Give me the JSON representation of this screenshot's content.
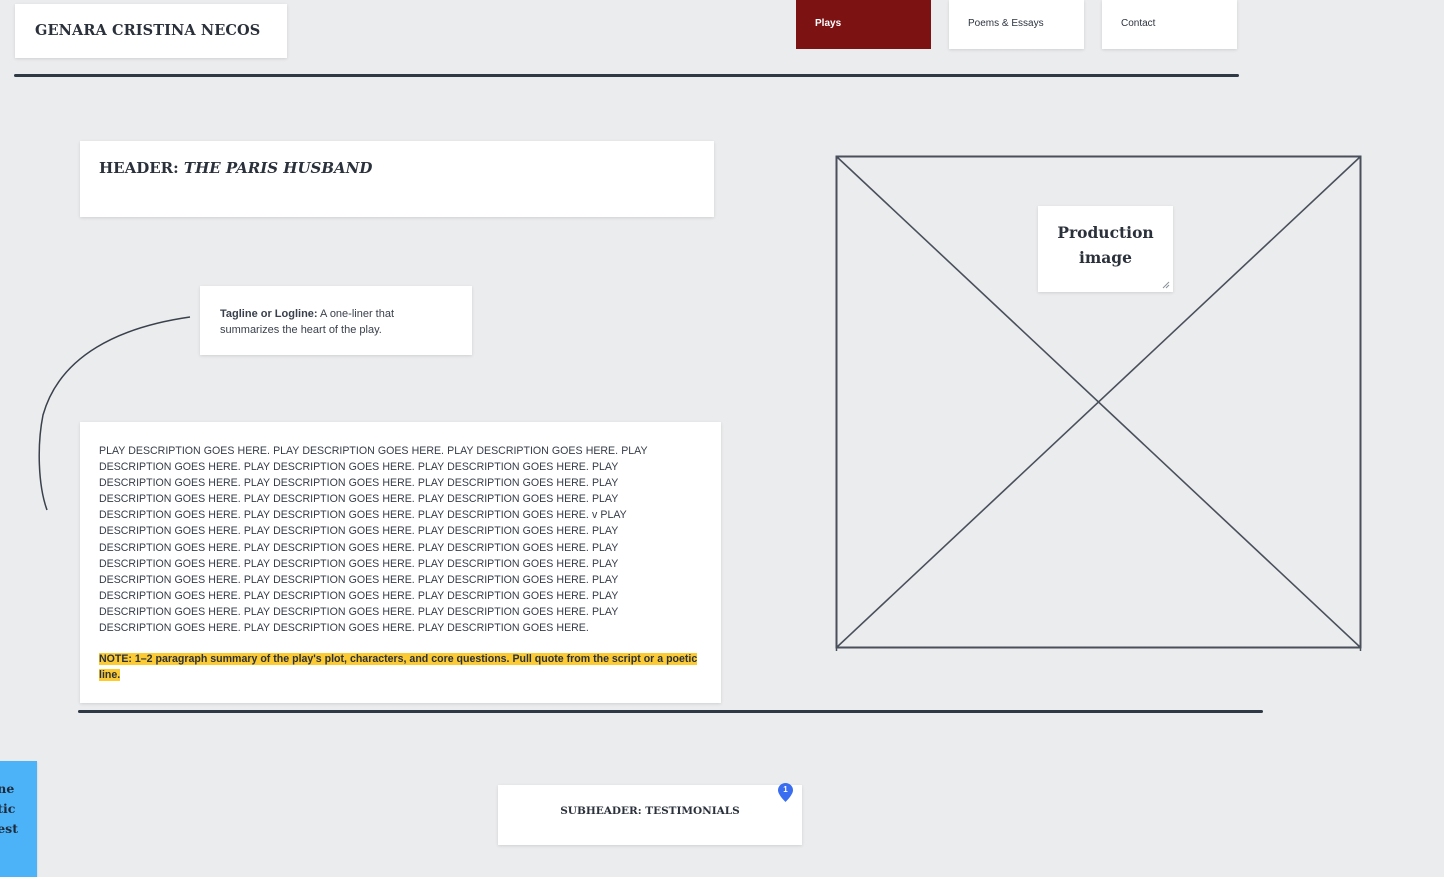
{
  "site": {
    "title": "GENARA CRISTINA NECOS"
  },
  "nav": {
    "plays": "Plays",
    "poems": "Poems & Essays",
    "contact": "Contact",
    "active_color": "#7d1213"
  },
  "play_header": {
    "prefix": "HEADER: ",
    "title": "THE PARIS HUSBAND"
  },
  "tagline": {
    "label": "Tagline or Logline:",
    "text": " A one-liner that summarizes the heart of the play."
  },
  "description": {
    "body": "PLAY DESCRIPTION GOES HERE. PLAY DESCRIPTION GOES HERE. PLAY DESCRIPTION GOES HERE. PLAY DESCRIPTION GOES HERE. PLAY DESCRIPTION GOES HERE. PLAY DESCRIPTION GOES HERE. PLAY DESCRIPTION GOES HERE. PLAY DESCRIPTION GOES HERE. PLAY DESCRIPTION GOES HERE. PLAY DESCRIPTION GOES HERE. PLAY DESCRIPTION GOES HERE. PLAY DESCRIPTION GOES HERE. PLAY DESCRIPTION GOES HERE. PLAY DESCRIPTION GOES HERE. PLAY DESCRIPTION GOES HERE. v PLAY DESCRIPTION GOES HERE. PLAY DESCRIPTION GOES HERE. PLAY DESCRIPTION GOES HERE. PLAY DESCRIPTION GOES HERE. PLAY DESCRIPTION GOES HERE. PLAY DESCRIPTION GOES HERE. PLAY DESCRIPTION GOES HERE. PLAY DESCRIPTION GOES HERE.  PLAY DESCRIPTION GOES HERE. PLAY DESCRIPTION GOES HERE. PLAY DESCRIPTION GOES HERE. PLAY DESCRIPTION GOES HERE. PLAY DESCRIPTION GOES HERE. PLAY DESCRIPTION GOES HERE. PLAY DESCRIPTION GOES HERE. PLAY DESCRIPTION GOES HERE. PLAY DESCRIPTION GOES HERE. PLAY DESCRIPTION GOES HERE. PLAY DESCRIPTION GOES HERE. PLAY DESCRIPTION GOES HERE. PLAY DESCRIPTION GOES HERE.",
    "note": "NOTE:  1–2 paragraph summary of the play's plot, characters, and core questions. Pull quote from the script or a poetic line.",
    "note_highlight_color": "#fccb33"
  },
  "production_image": {
    "label": "Production image"
  },
  "testimonials": {
    "label": "SUBHEADER: TESTIMONIALS"
  },
  "comment_pin": {
    "count": "1",
    "color": "#3a6df0"
  },
  "sticky_note": {
    "lines": [
      "ne",
      "tic",
      "est"
    ],
    "color": "#4cb3f8"
  }
}
